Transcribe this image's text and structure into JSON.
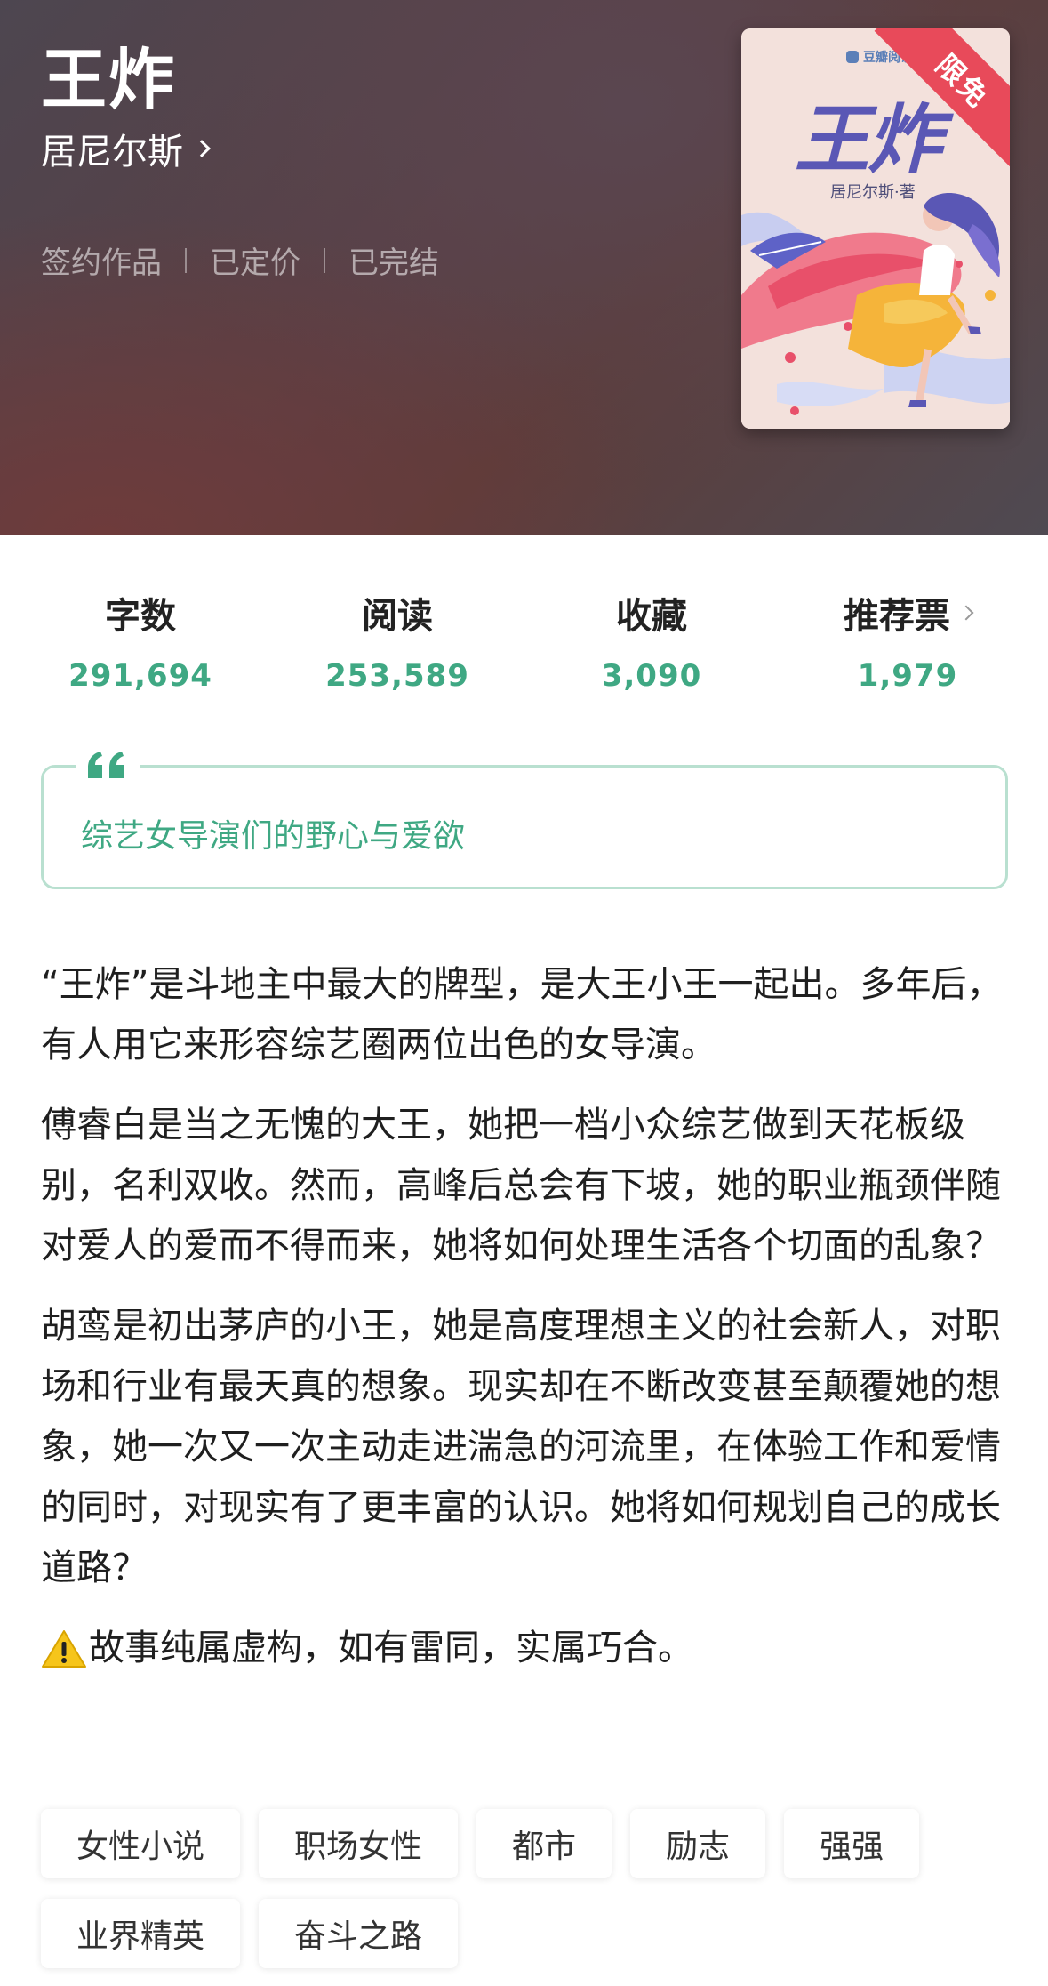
{
  "book": {
    "title": "王炸",
    "author": "居尼尔斯",
    "status": [
      "签约作品",
      "已定价",
      "已完结"
    ]
  },
  "cover": {
    "brand": "豆瓣阅读",
    "title": "王炸",
    "author_line": "居尼尔斯·著",
    "ribbon": "限免"
  },
  "stats": [
    {
      "label": "字数",
      "value": "291,694"
    },
    {
      "label": "阅读",
      "value": "253,589"
    },
    {
      "label": "收藏",
      "value": "3,090"
    },
    {
      "label": "推荐票",
      "value": "1,979"
    }
  ],
  "tagline": "综艺女导演们的野心与爱欲",
  "description": [
    "“王炸”是斗地主中最大的牌型，是大王小王一起出。多年后，有人用它来形容综艺圈两位出色的女导演。",
    "傅睿白是当之无愧的大王，她把一档小众综艺做到天花板级别，名利双收。然而，高峰后总会有下坡，她的职业瓶颈伴随对爱人的爱而不得而来，她将如何处理生活各个切面的乱象？",
    "胡鸾是初出茅庐的小王，她是高度理想主义的社会新人，对职场和行业有最天真的想象。现实却在不断改变甚至颠覆她的想象，她一次又一次主动走进湍急的河流里，在体验工作和爱情的同时，对现实有了更丰富的认识。她将如何规划自己的成长道路？"
  ],
  "disclaimer": "故事纯属虚构，如有雷同，实属巧合。",
  "tags": [
    [
      "女性小说",
      "职场女性",
      "都市",
      "励志",
      "强强"
    ],
    [
      "业界精英",
      "奋斗之路"
    ]
  ],
  "colors": {
    "accent": "#3fa883",
    "quote_border": "#b9e0d0",
    "ribbon": "#e84a5a"
  }
}
